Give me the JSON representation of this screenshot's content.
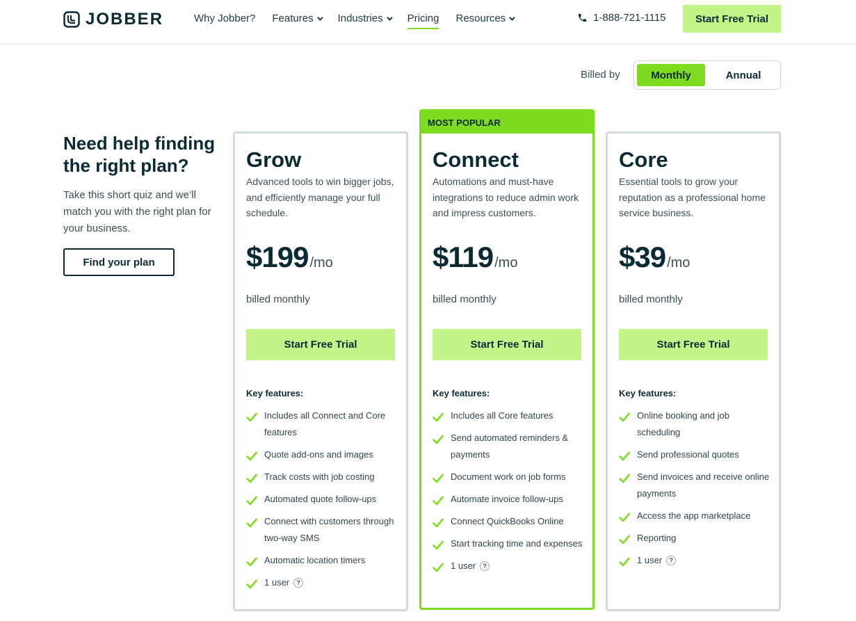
{
  "header": {
    "logo_text": "JOBBER",
    "nav": [
      {
        "label": "Why Jobber?",
        "dropdown": false,
        "active": false
      },
      {
        "label": "Features",
        "dropdown": true,
        "active": false
      },
      {
        "label": "Industries",
        "dropdown": true,
        "active": false
      },
      {
        "label": "Pricing",
        "dropdown": false,
        "active": true
      },
      {
        "label": "Resources",
        "dropdown": true,
        "active": false
      }
    ],
    "phone": "1-888-721-1115",
    "cta_label": "Start Free Trial"
  },
  "billing": {
    "label": "Billed by",
    "options": [
      "Monthly",
      "Annual"
    ],
    "selected": "Monthly"
  },
  "help": {
    "title": "Need help finding the right plan?",
    "text": "Take this short quiz and we’ll match you with the right plan for your business.",
    "button_label": "Find your plan"
  },
  "plans": [
    {
      "name": "Grow",
      "description": "Advanced tools to win bigger jobs, and efficiently manage your full schedule.",
      "price": "$199",
      "per": "/mo",
      "billed": "billed monthly",
      "cta_label": "Start Free Trial",
      "features_label": "Key features:",
      "features": [
        "Includes all Connect and Core features",
        "Quote add-ons and images",
        "Track costs with job costing",
        "Automated quote follow-ups",
        "Connect with customers through two-way SMS",
        "Automatic location timers",
        "1 user"
      ]
    },
    {
      "name": "Connect",
      "badge": "MOST POPULAR",
      "description": "Automations and must-have integrations to reduce admin work and impress customers.",
      "price": "$119",
      "per": "/mo",
      "billed": "billed monthly",
      "cta_label": "Start Free Trial",
      "features_label": "Key features:",
      "features": [
        "Includes all Core features",
        "Send automated reminders & payments",
        "Document work on job forms",
        "Automate invoice follow-ups",
        "Connect QuickBooks Online",
        "Start tracking time and expenses",
        "1 user"
      ]
    },
    {
      "name": "Core",
      "description": "Essential tools to grow your reputation as a professional home service business.",
      "price": "$39",
      "per": "/mo",
      "billed": "billed monthly",
      "cta_label": "Start Free Trial",
      "features_label": "Key features:",
      "features": [
        "Online booking and job scheduling",
        "Send professional quotes",
        "Send invoices and receive online payments",
        "Access the app marketplace",
        "Reporting",
        "1 user"
      ]
    }
  ],
  "help_badge": "?",
  "colors": {
    "accent": "#7ddc1f",
    "cta": "#c3f48a",
    "ink": "#0b2a33"
  }
}
